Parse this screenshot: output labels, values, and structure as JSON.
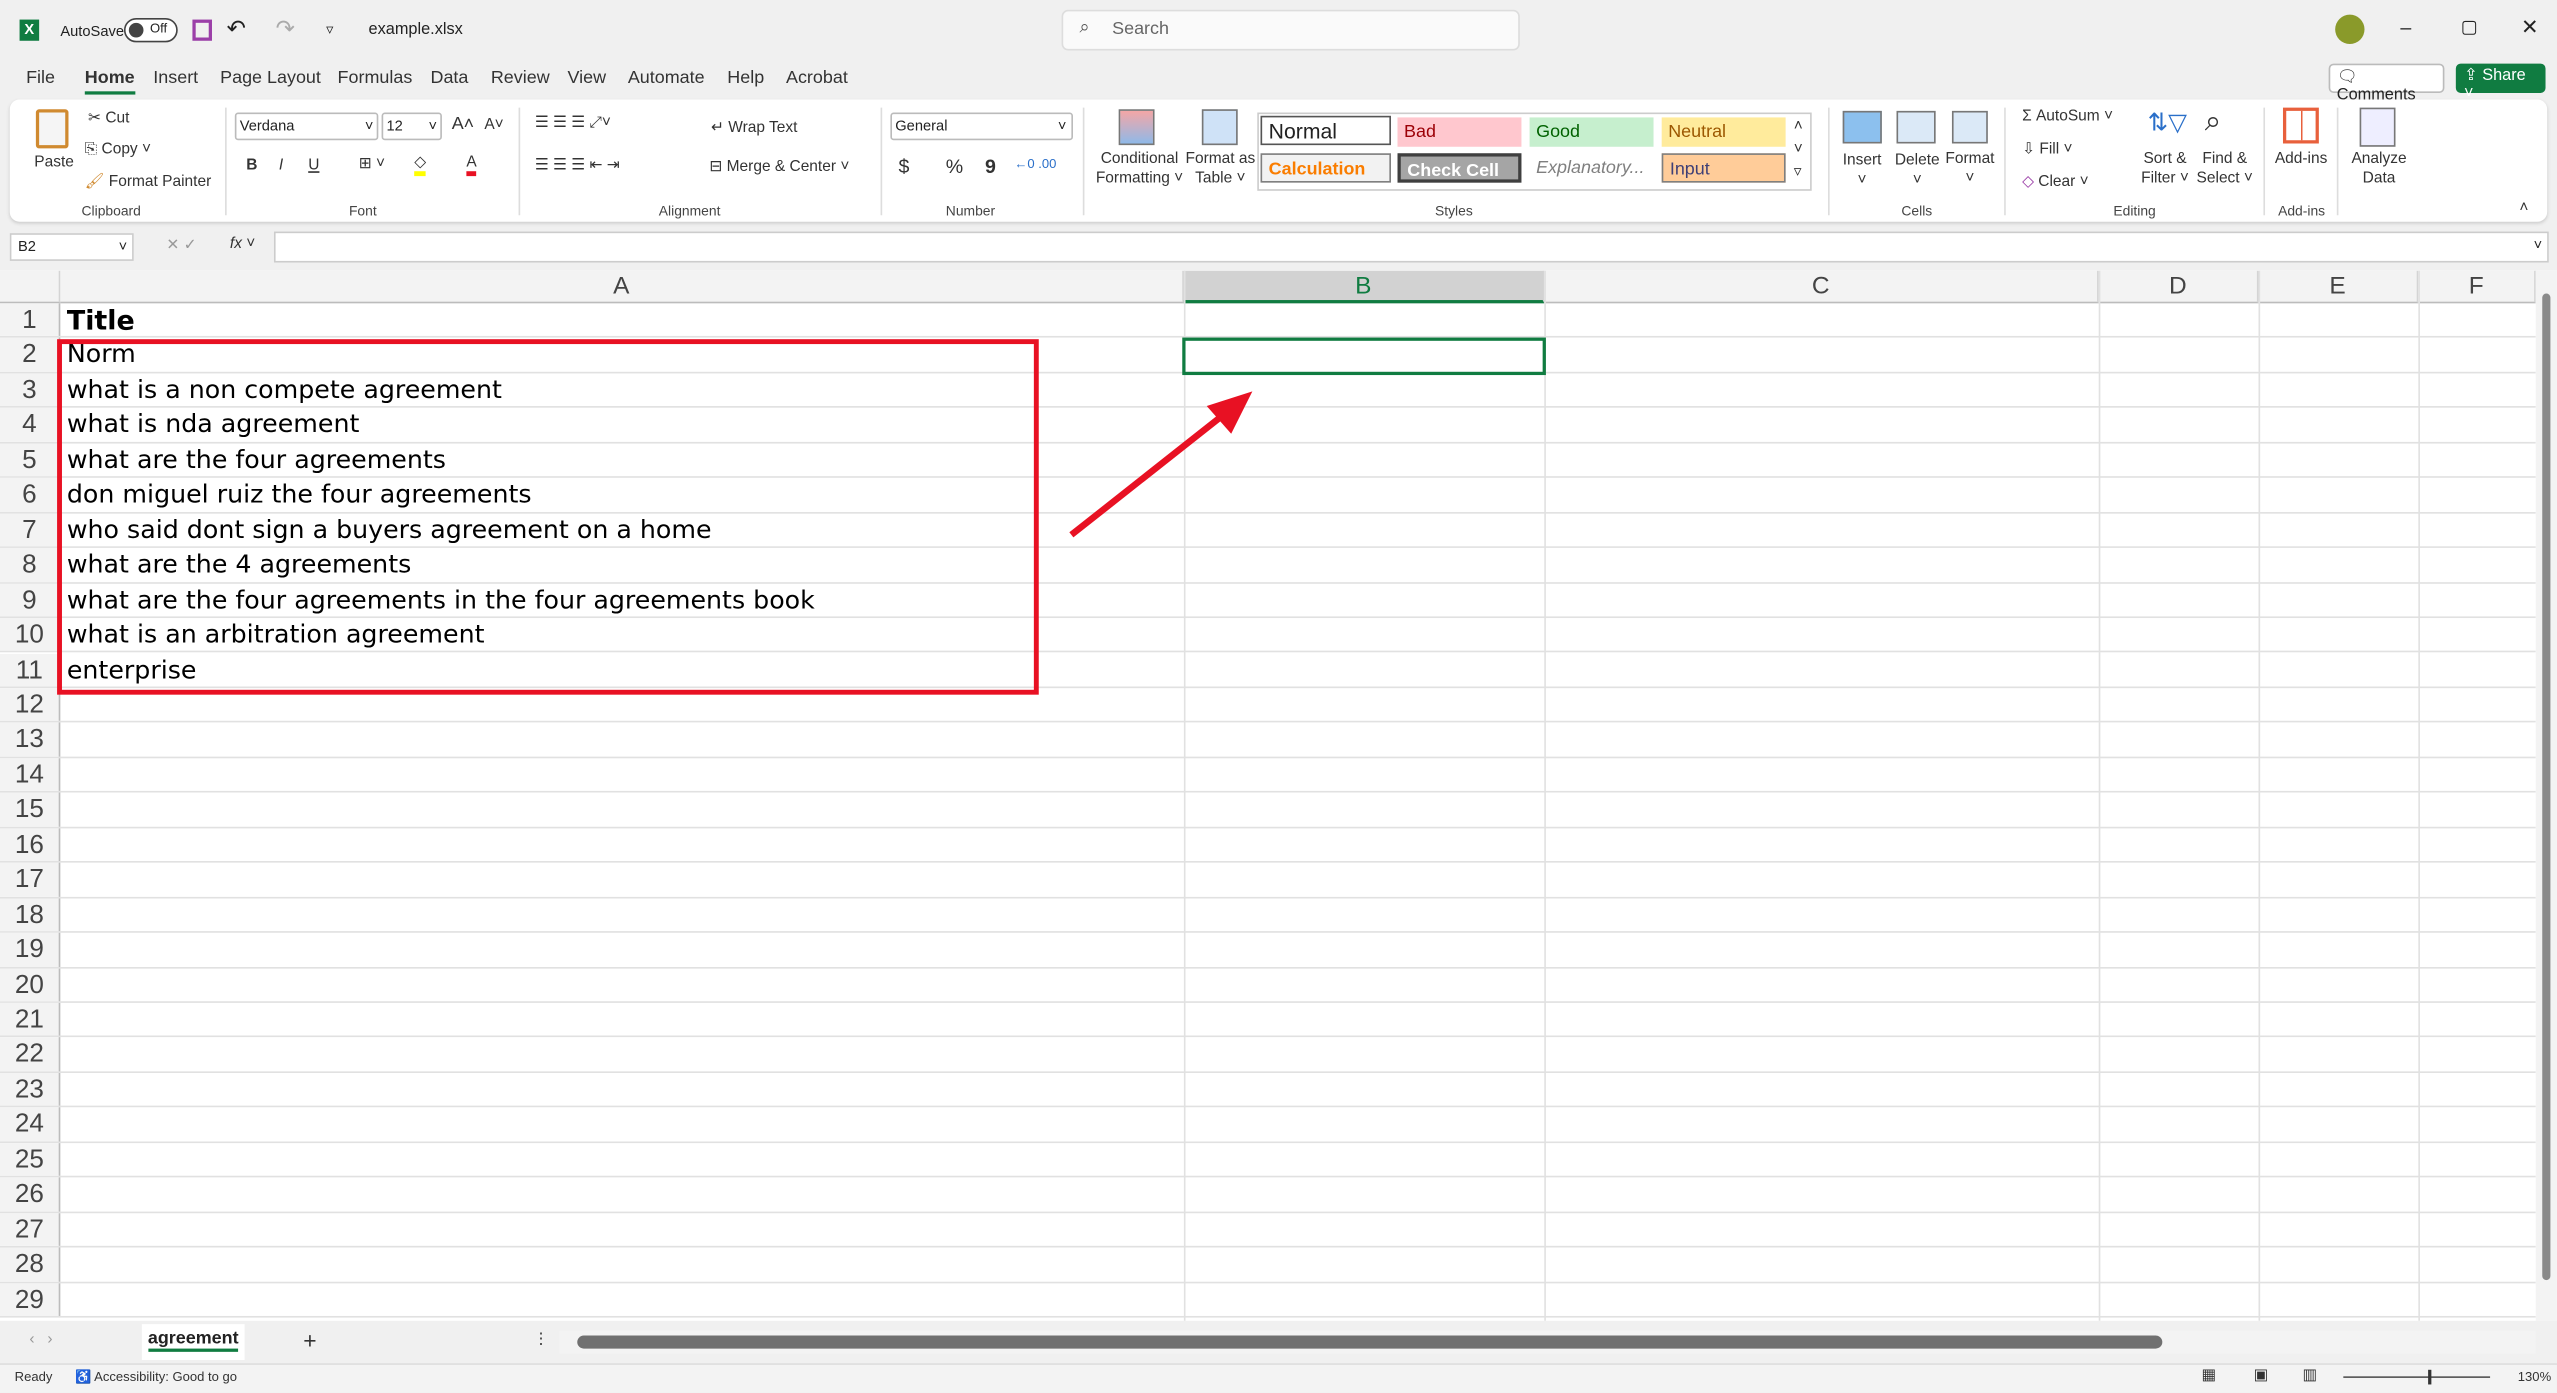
{
  "titlebar": {
    "autosave_label": "AutoSave",
    "autosave_state": "Off",
    "filename": "example.xlsx",
    "search_placeholder": "Search"
  },
  "menu": {
    "tabs": [
      "File",
      "Home",
      "Insert",
      "Page Layout",
      "Formulas",
      "Data",
      "Review",
      "View",
      "Automate",
      "Help",
      "Acrobat"
    ],
    "active": "Home",
    "comments": "Comments",
    "share": "Share"
  },
  "ribbon": {
    "clipboard": {
      "paste": "Paste",
      "cut": "Cut",
      "copy": "Copy",
      "format_painter": "Format Painter",
      "label": "Clipboard"
    },
    "font": {
      "name": "Verdana",
      "size": "12",
      "label": "Font",
      "bold": "B",
      "italic": "I",
      "underline": "U"
    },
    "alignment": {
      "wrap": "Wrap Text",
      "merge": "Merge & Center",
      "label": "Alignment"
    },
    "number": {
      "format": "General",
      "label": "Number",
      "currency": "$",
      "percent": "%",
      "comma": "9"
    },
    "styles": {
      "cond1": "Conditional",
      "cond2": "Formatting",
      "fat1": "Format as",
      "fat2": "Table",
      "normal": "Normal",
      "bad": "Bad",
      "good": "Good",
      "neutral": "Neutral",
      "calculation": "Calculation",
      "check": "Check Cell",
      "explanatory": "Explanatory...",
      "input": "Input",
      "label": "Styles"
    },
    "cells": {
      "insert": "Insert",
      "delete": "Delete",
      "format": "Format",
      "label": "Cells"
    },
    "editing": {
      "autosum": "AutoSum",
      "fill": "Fill",
      "clear": "Clear",
      "sort1": "Sort &",
      "sort2": "Filter",
      "find1": "Find &",
      "find2": "Select",
      "label": "Editing"
    },
    "addins": {
      "addins": "Add-ins",
      "analyze1": "Analyze",
      "analyze2": "Data",
      "label": "Add-ins"
    },
    "colors": {
      "accent": "#107c41",
      "highlight": "#ffff00",
      "font_color": "#e81123"
    }
  },
  "formula_bar": {
    "name_box": "B2",
    "fx": "fx",
    "value": ""
  },
  "columns": [
    "A",
    "B",
    "C",
    "D",
    "E",
    "F"
  ],
  "selected_cell": "B2",
  "rows": [
    {
      "n": "1",
      "a": "Title"
    },
    {
      "n": "2",
      "a": "Norm"
    },
    {
      "n": "3",
      "a": "what is a non compete agreement"
    },
    {
      "n": "4",
      "a": "what is nda agreement"
    },
    {
      "n": "5",
      "a": "what are the four agreements"
    },
    {
      "n": "6",
      "a": "don miguel ruiz the four agreements"
    },
    {
      "n": "7",
      "a": "who said dont sign a buyers agreement on a home"
    },
    {
      "n": "8",
      "a": "what are the 4 agreements"
    },
    {
      "n": "9",
      "a": "what are the four agreements in the four agreements book"
    },
    {
      "n": "10",
      "a": "what is an arbitration agreement"
    },
    {
      "n": "11",
      "a": "enterprise"
    },
    {
      "n": "12",
      "a": ""
    },
    {
      "n": "13",
      "a": ""
    },
    {
      "n": "14",
      "a": ""
    },
    {
      "n": "15",
      "a": ""
    },
    {
      "n": "16",
      "a": ""
    },
    {
      "n": "17",
      "a": ""
    },
    {
      "n": "18",
      "a": ""
    },
    {
      "n": "19",
      "a": ""
    },
    {
      "n": "20",
      "a": ""
    },
    {
      "n": "21",
      "a": ""
    },
    {
      "n": "22",
      "a": ""
    },
    {
      "n": "23",
      "a": ""
    },
    {
      "n": "24",
      "a": ""
    },
    {
      "n": "25",
      "a": ""
    },
    {
      "n": "26",
      "a": ""
    },
    {
      "n": "27",
      "a": ""
    },
    {
      "n": "28",
      "a": ""
    },
    {
      "n": "29",
      "a": ""
    }
  ],
  "sheets": {
    "tabs": [
      "agreement"
    ],
    "add": "+"
  },
  "status": {
    "ready": "Ready",
    "accessibility": "Accessibility: Good to go",
    "zoom": "130%"
  },
  "annotation": {
    "box_color": "#e81123"
  }
}
